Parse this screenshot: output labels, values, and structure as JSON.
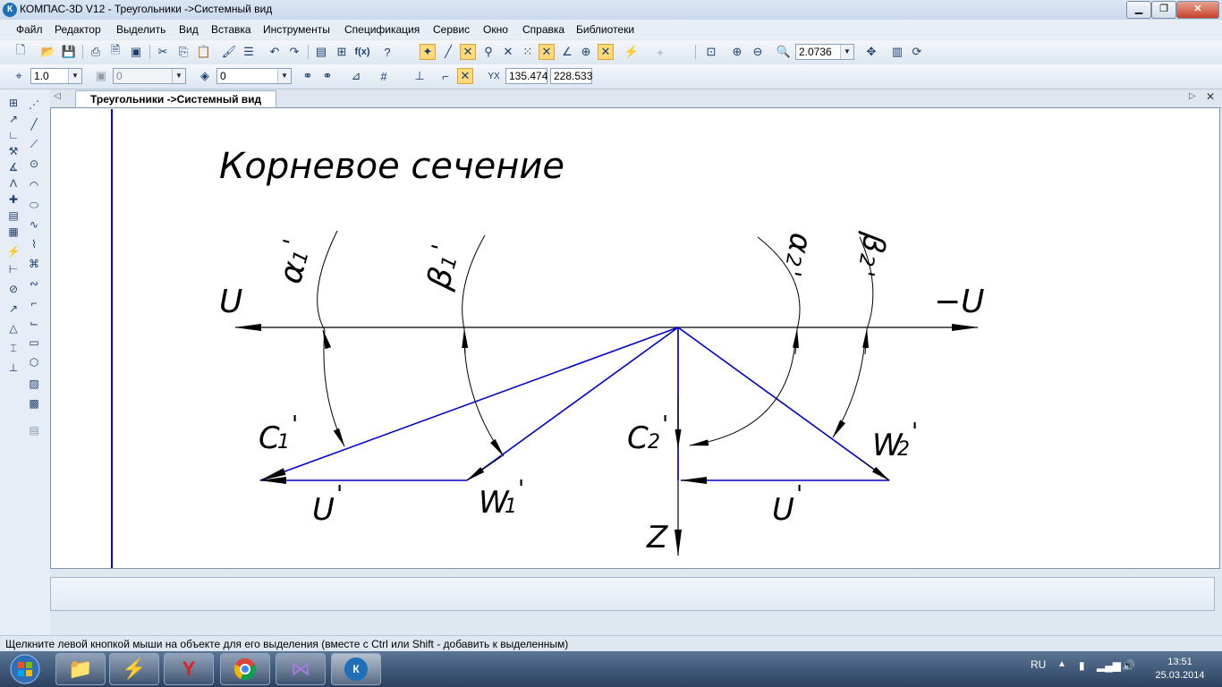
{
  "window": {
    "title": "КОМПАС-3D V12 - Треугольники ->Системный вид",
    "app_icon": "kompas-logo-icon",
    "controls": [
      "minimize-icon",
      "maximize-icon",
      "close-icon"
    ]
  },
  "menu": [
    "Файл",
    "Редактор",
    "Выделить",
    "Вид",
    "Вставка",
    "Инструменты",
    "Спецификация",
    "Сервис",
    "Окно",
    "Справка",
    "Библиотеки"
  ],
  "toolbar1": {
    "zoom_value": "2.0736"
  },
  "toolbar2": {
    "line_scale": "1.0",
    "layer_value": "0",
    "style_value": "0",
    "coord_x": "135.474",
    "coord_y": "228.533"
  },
  "tab": {
    "label": "Треугольники ->Системный вид"
  },
  "drawing": {
    "title": "Корневое сечение",
    "labels": {
      "u_left": "U",
      "u_right": "−U",
      "z": "Z",
      "c1": "C",
      "c1_sub": "1",
      "c2": "C",
      "c2_sub": "2",
      "w1": "W",
      "w1_sub": "1",
      "w2": "W",
      "w2_sub": "2",
      "u_prime_left": "U",
      "u_prime_right": "U",
      "alpha1": "α",
      "alpha1_sub": "1",
      "beta1": "β",
      "beta1_sub": "1",
      "alpha2": "α",
      "alpha2_sub": "2",
      "beta2": "β",
      "beta2_sub": "2",
      "prime": "'"
    },
    "line_color": "#0000c8"
  },
  "status": {
    "hint": "Щелкните левой кнопкой мыши на объекте для его выделения (вместе с Ctrl или Shift - добавить к выделенным)"
  },
  "taskbar": {
    "lang": "RU",
    "time": "13:51",
    "date": "25.03.2014"
  }
}
